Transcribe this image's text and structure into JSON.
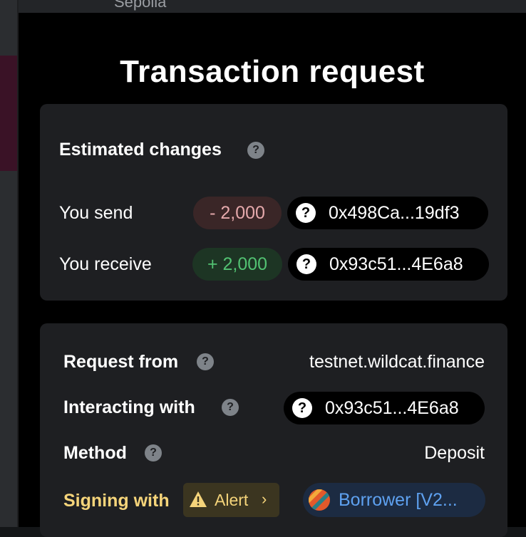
{
  "network": {
    "name": "Sepolia"
  },
  "title": "Transaction request",
  "estimated_changes": {
    "heading": "Estimated changes",
    "send": {
      "label": "You send",
      "amount": "- 2,000",
      "address": "0x498Ca...19df3"
    },
    "receive": {
      "label": "You receive",
      "amount": "+ 2,000",
      "address": "0x93c51...4E6a8"
    }
  },
  "details": {
    "request_from": {
      "label": "Request from",
      "value": "testnet.wildcat.finance"
    },
    "interacting_with": {
      "label": "Interacting with",
      "address": "0x93c51...4E6a8"
    },
    "method": {
      "label": "Method",
      "value": "Deposit"
    },
    "signing_with": {
      "label": "Signing with",
      "alert": "Alert",
      "account": "Borrower [V2..."
    }
  },
  "icons": {
    "info": "question-circle-icon",
    "unknown_token": "question-mark-icon",
    "alert": "warning-triangle-icon",
    "chevron": "chevron-right-icon"
  },
  "colors": {
    "send": "#e5a9ac",
    "receive": "#52c272",
    "warning": "#f5d47a",
    "account_link": "#5ea1f0"
  }
}
